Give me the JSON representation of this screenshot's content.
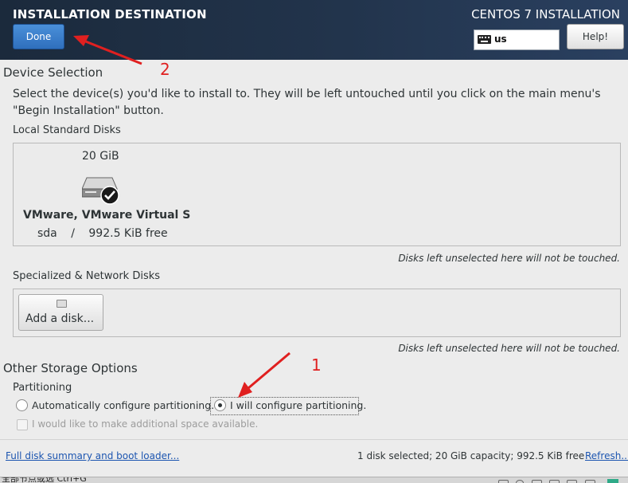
{
  "header": {
    "title": "INSTALLATION DESTINATION",
    "right_title": "CENTOS 7 INSTALLATION",
    "done_label": "Done",
    "keyboard_layout": "us",
    "help_label": "Help!"
  },
  "device_selection": {
    "title": "Device Selection",
    "description_line1": "Select the device(s) you'd like to install to.  They will be left untouched until you click on the main menu's",
    "description_line2": "\"Begin Installation\" button.",
    "local_disks_label": "Local Standard Disks",
    "disk": {
      "size": "20 GiB",
      "name": "VMware, VMware Virtual S",
      "device": "sda",
      "separator": "/",
      "free": "992.5 KiB free",
      "selected": true
    },
    "note_local": "Disks left unselected here will not be touched.",
    "specialized_label": "Specialized & Network Disks",
    "add_disk_label": "Add a disk...",
    "note_specialized": "Disks left unselected here will not be touched."
  },
  "other_storage": {
    "title": "Other Storage Options",
    "partitioning_label": "Partitioning",
    "auto_option": "Automatically configure partitioning.",
    "manual_option": "I will configure partitioning.",
    "selected_option": "manual",
    "additional_space": "I would like to make additional space available."
  },
  "footer": {
    "summary_link": "Full disk summary and boot loader...",
    "summary_text": "1 disk selected; 20 GiB capacity; 992.5 KiB free",
    "refresh_link": "Refresh..."
  },
  "annotations": {
    "label_1": "1",
    "label_2": "2",
    "color": "#e02020"
  },
  "taskbar": {
    "text": "全部节点或选 Ctrl+G"
  }
}
